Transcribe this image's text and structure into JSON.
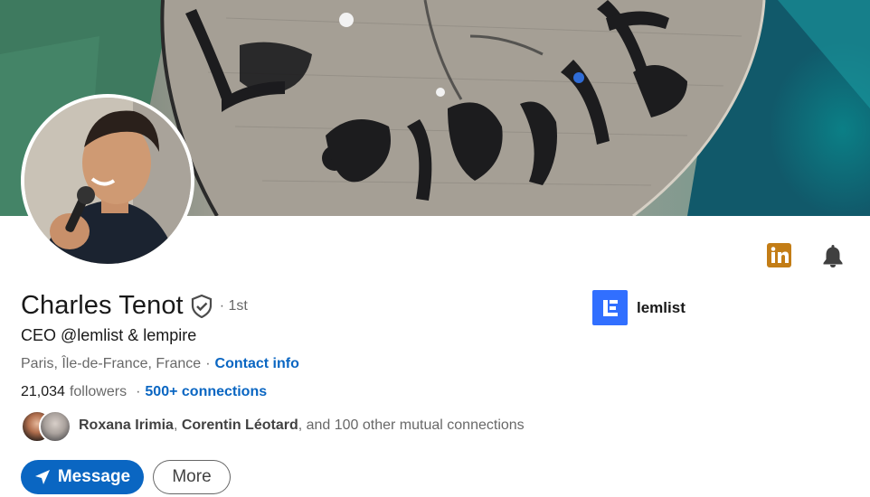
{
  "profile": {
    "name": "Charles Tenot",
    "degree": "· 1st",
    "headline": "CEO @lemlist & lempire",
    "location": "Paris, Île-de-France, France",
    "contact_info_label": "Contact info",
    "followers_count": "21,034",
    "followers_label": "followers",
    "connections_label": "500+ connections",
    "mutual": {
      "name1": "Roxana Irimia",
      "name2": "Corentin Léotard",
      "rest": ", and 100 other mutual connections"
    }
  },
  "actions": {
    "message_label": "Message",
    "more_label": "More"
  },
  "company": {
    "name": "lemlist"
  },
  "icons": {
    "linkedin": "linkedin-icon",
    "bell": "bell-icon",
    "verified": "verified-shield-icon",
    "send": "send-icon"
  },
  "colors": {
    "link": "#0a66c2",
    "primary_button": "#0a66c2",
    "company_logo": "#316fff",
    "linkedin_badge": "#c37d16"
  }
}
